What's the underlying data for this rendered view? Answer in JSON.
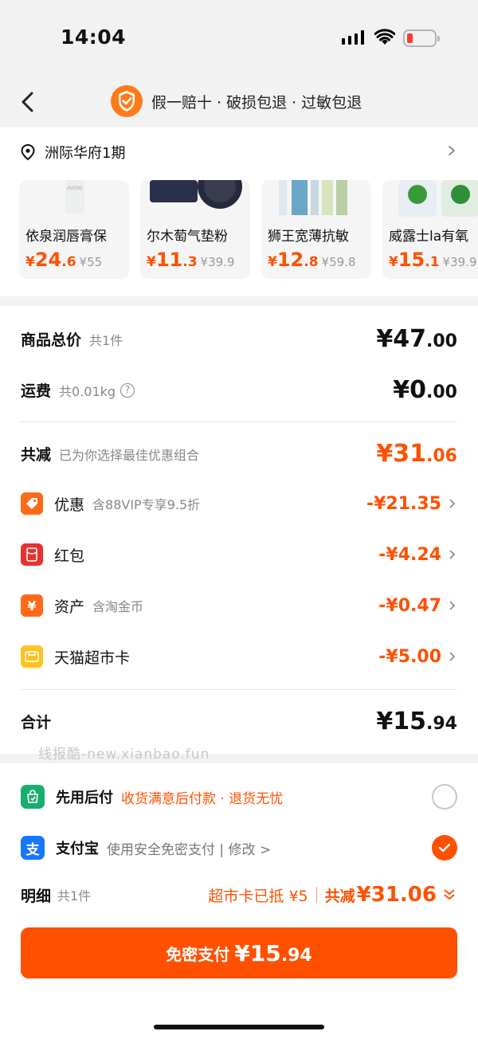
{
  "status_bar": {
    "time": "14:04"
  },
  "nav": {
    "title": "假一赔十 · 破损包退 · 过敏包退"
  },
  "address": {
    "name": "洲际华府1期"
  },
  "products": [
    {
      "name": "依泉润唇膏保",
      "currency": "¥",
      "price_main": "24",
      "price_dec": ".6",
      "original": "¥55"
    },
    {
      "name": "尔木萄气垫粉",
      "currency": "¥",
      "price_main": "11",
      "price_dec": ".3",
      "original": "¥39.9"
    },
    {
      "name": "狮王宽薄抗敏",
      "currency": "¥",
      "price_main": "12",
      "price_dec": ".8",
      "original": "¥59.8"
    },
    {
      "name": "威露士la有氧",
      "currency": "¥",
      "price_main": "15",
      "price_dec": ".1",
      "original": "¥39.9"
    }
  ],
  "summary": {
    "goods_total_label": "商品总价",
    "goods_total_sub": "共1件",
    "goods_total_main": "¥47",
    "goods_total_dec": ".00",
    "shipping_label": "运费",
    "shipping_sub": "共0.01kg",
    "shipping_main": "¥0",
    "shipping_dec": ".00",
    "reduce_label": "共减",
    "reduce_sub": "已为你选择最佳优惠组合",
    "reduce_main": "¥31",
    "reduce_dec": ".06",
    "total_label": "合计",
    "total_main": "¥15",
    "total_dec": ".94"
  },
  "discounts": [
    {
      "label": "优惠",
      "sub": "含88VIP专享9.5折",
      "amount": "-¥21.35"
    },
    {
      "label": "红包",
      "sub": "",
      "amount": "-¥4.24"
    },
    {
      "label": "资产",
      "sub": "含淘金币",
      "amount": "-¥0.47"
    },
    {
      "label": "天猫超市卡",
      "sub": "",
      "amount": "-¥5.00"
    }
  ],
  "watermark": "线报酷-new.xianbao.fun",
  "payment": {
    "later_name": "先用后付",
    "later_desc": "收货满意后付款 · 退货无忧",
    "alipay_name": "支付宝",
    "alipay_desc": "使用安全免密支付 | 修改 >"
  },
  "detail": {
    "label": "明细",
    "sub": "共1件",
    "card_text": "超市卡已抵 ¥5",
    "reduce_text": "共减",
    "reduce_amount": "¥31.06"
  },
  "button": {
    "label": "免密支付",
    "amount_main": "¥15",
    "amount_dec": ".94"
  },
  "colors": {
    "accent": "#ff5000",
    "alipay": "#1677ff",
    "later": "#1aad6e",
    "hongbao": "#e8302e",
    "card": "#ffc21f"
  }
}
